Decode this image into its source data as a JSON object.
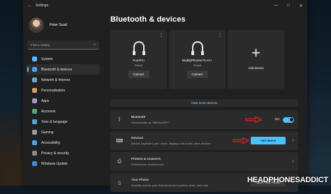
{
  "window": {
    "title": "Settings",
    "back_icon": "arrow-left-icon",
    "controls": [
      "—",
      "□",
      "✕"
    ]
  },
  "profile": {
    "name": "Peter Susić"
  },
  "search": {
    "placeholder": "Find a setting",
    "icon": "search-icon"
  },
  "sidebar": {
    "items": [
      {
        "label": "System",
        "icon": "monitor-icon",
        "color": "#4cc2ff"
      },
      {
        "label": "Bluetooth & devices",
        "icon": "bluetooth-icon",
        "color": "#4c9fff",
        "active": true
      },
      {
        "label": "Network & internet",
        "icon": "wifi-icon",
        "color": "#6aa7d8"
      },
      {
        "label": "Personalisation",
        "icon": "brush-icon",
        "color": "#e39a5a"
      },
      {
        "label": "Apps",
        "icon": "apps-icon",
        "color": "#9a9ec8"
      },
      {
        "label": "Accounts",
        "icon": "person-icon",
        "color": "#3fb27f"
      },
      {
        "label": "Time & language",
        "icon": "globe-clock-icon",
        "color": "#4ea8e0"
      },
      {
        "label": "Gaming",
        "icon": "gamepad-icon",
        "color": "#9a9a9a"
      },
      {
        "label": "Accessibility",
        "icon": "accessibility-icon",
        "color": "#4aa3e6"
      },
      {
        "label": "Privacy & security",
        "icon": "shield-icon",
        "color": "#8a8a8a"
      },
      {
        "label": "Windows Update",
        "icon": "refresh-icon",
        "color": "#3e8ee0"
      }
    ]
  },
  "main": {
    "title": "Bluetooth & devices",
    "devices": [
      {
        "name": "PuroPro",
        "status": "Paired",
        "button": "Connect"
      },
      {
        "name": "BuddyPhones PLAY+",
        "status": "Paired",
        "button": "Connect"
      }
    ],
    "add_card": {
      "label": "Add device"
    },
    "view_more": "View more devices",
    "bluetooth": {
      "title": "Bluetooth",
      "subtitle": "Discoverable as \"BRDAUSPC\"",
      "state": "On",
      "enabled": true
    },
    "devices_row": {
      "title": "Devices",
      "subtitle": "Mouse, keyboard, pen, audio, displays and docks, other devices",
      "button": "Add device"
    },
    "printers_row": {
      "title": "Printers & scanners",
      "subtitle": "Preferences, troubleshoot"
    },
    "phone_row": {
      "title": "Your Phone",
      "subtitle": "Instantly access your Android device's photos, texts, and more",
      "button": "Open Your Phone"
    }
  },
  "annotation_color": "#e02020",
  "watermark": "HEADPHONESADDICT"
}
